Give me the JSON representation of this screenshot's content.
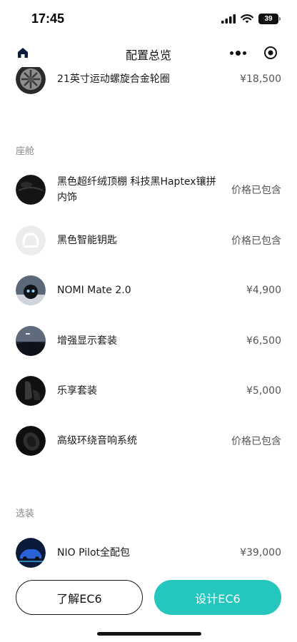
{
  "status_bar": {
    "time": "17:45",
    "battery": "39"
  },
  "nav": {
    "title": "配置总览"
  },
  "partial_item": {
    "label": "21英寸运动螺旋合金轮圈",
    "price": "¥18,500"
  },
  "cabin": {
    "heading": "座舱",
    "items": [
      {
        "label": "黑色超纤绒顶棚 科技黑Haptex镶拼内饰",
        "price": "价格已包含",
        "icon": "headliner-thumb"
      },
      {
        "label": "黑色智能钥匙",
        "price": "价格已包含",
        "icon": "nio-key-thumb"
      },
      {
        "label": "NOMI Mate 2.0",
        "price": "¥4,900",
        "icon": "nomi-thumb"
      },
      {
        "label": "增强显示套装",
        "price": "¥6,500",
        "icon": "display-thumb"
      },
      {
        "label": "乐享套装",
        "price": "¥5,000",
        "icon": "seat-thumb"
      },
      {
        "label": "高级环绕音响系统",
        "price": "价格已包含",
        "icon": "speaker-thumb"
      }
    ]
  },
  "options": {
    "heading": "选装",
    "items": [
      {
        "label": "NIO Pilot全配包",
        "price": "¥39,000",
        "icon": "pilot-car-thumb"
      }
    ]
  },
  "bottom": {
    "learn_label": "了解EC6",
    "design_label": "设计EC6"
  },
  "colors": {
    "accent": "#25c6bd",
    "text": "#1a1a1a",
    "muted": "#8a8a8a"
  }
}
